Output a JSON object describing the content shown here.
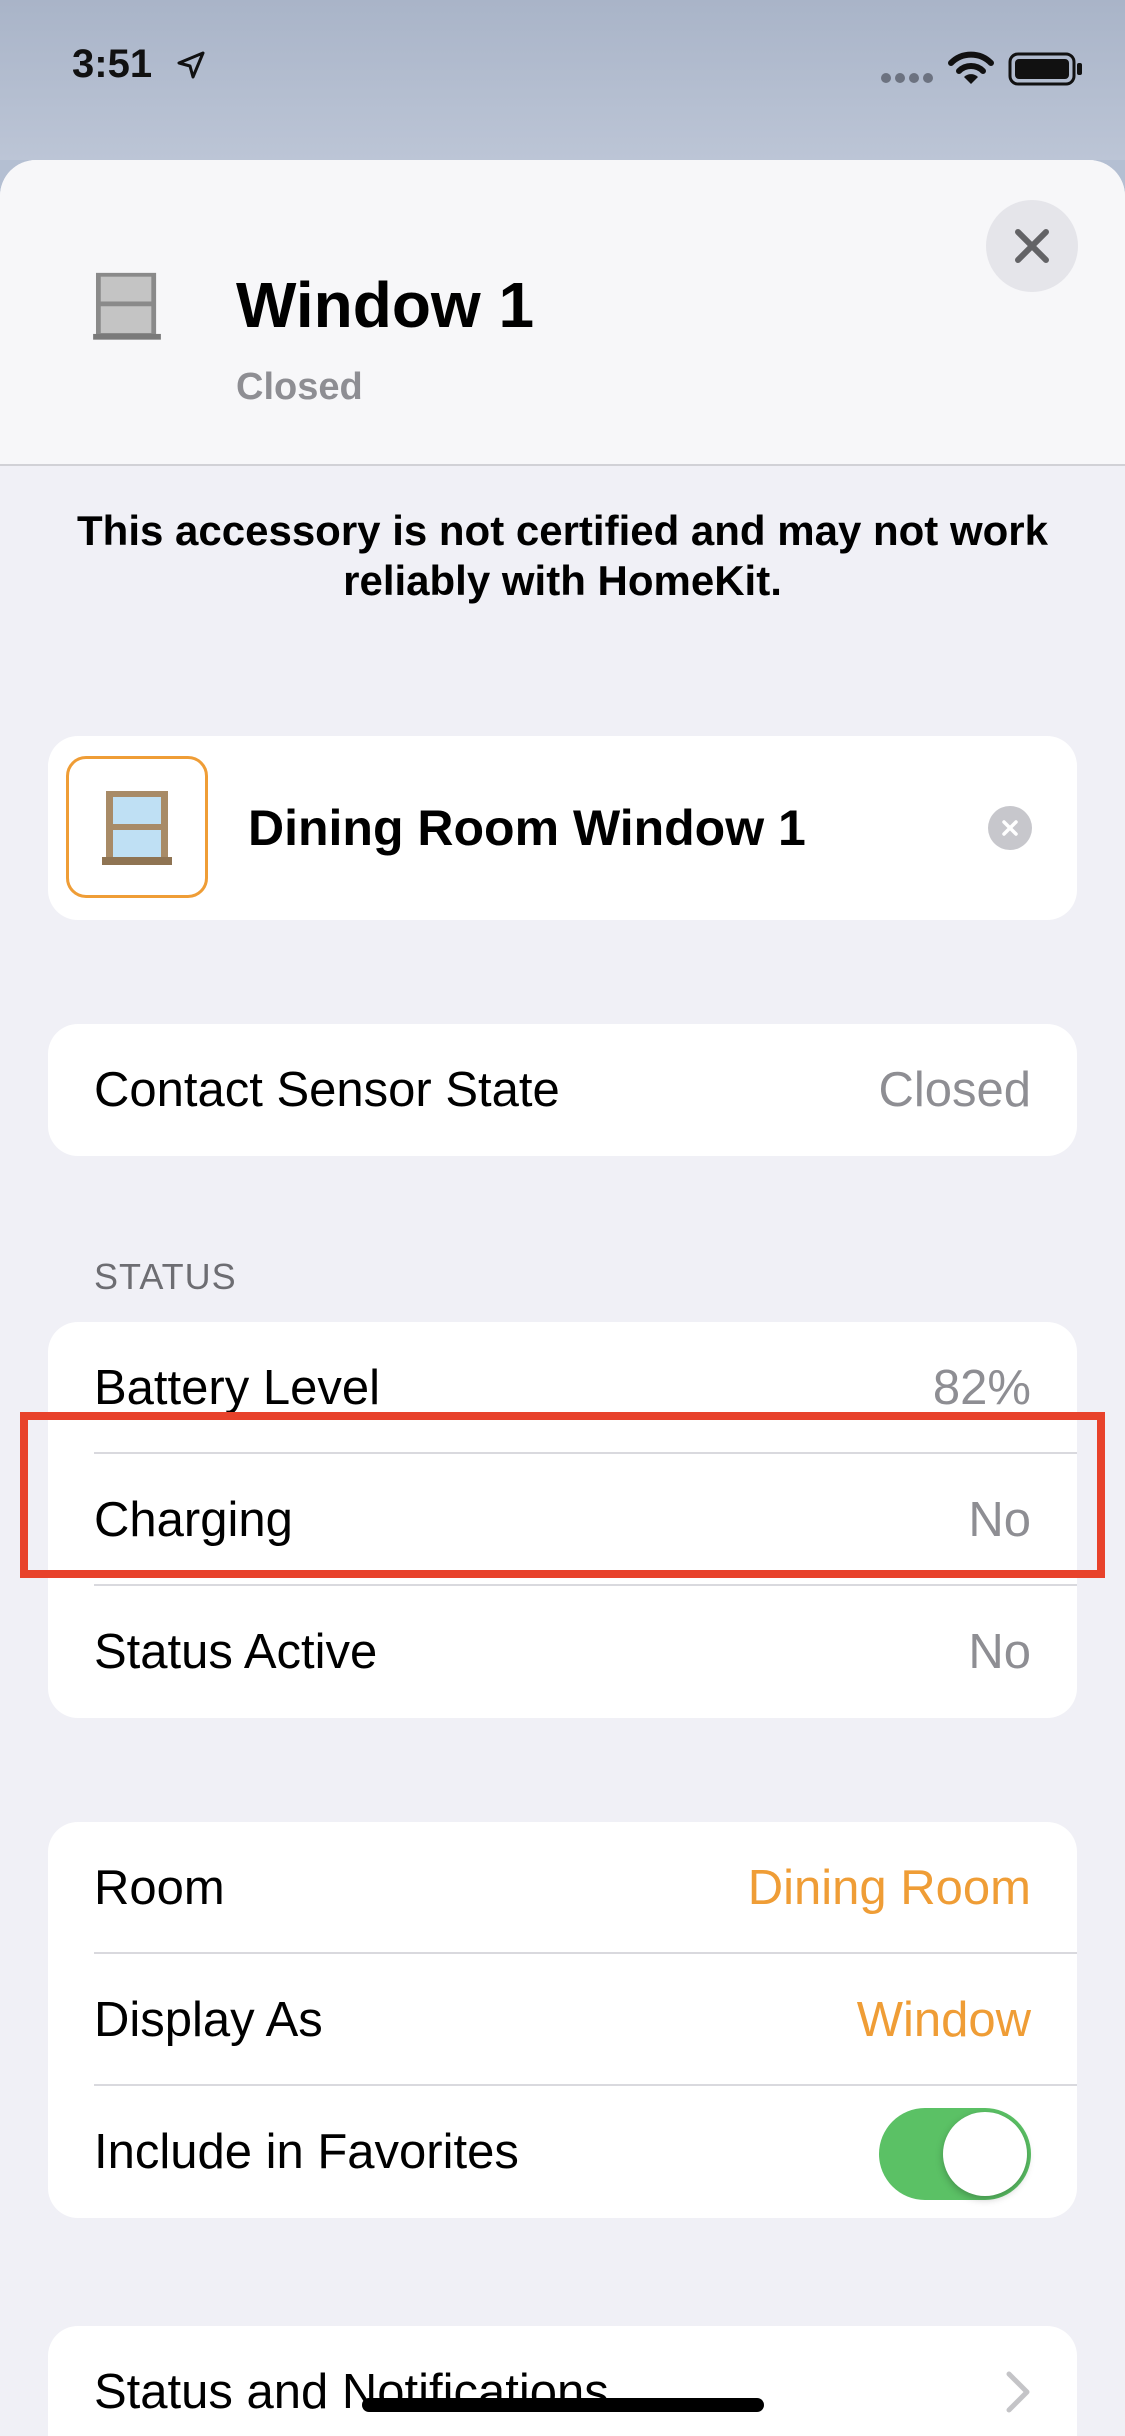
{
  "status_bar": {
    "time": "3:51"
  },
  "header": {
    "title": "Window 1",
    "subtitle": "Closed",
    "icon": "window-icon",
    "close_icon": "close-icon"
  },
  "notice": "This accessory is not certified and may not work reliably with HomeKit.",
  "accessory": {
    "name": "Dining Room Window 1",
    "icon": "window-icon"
  },
  "contact": {
    "label": "Contact Sensor State",
    "value": "Closed"
  },
  "status_section": {
    "header": "STATUS",
    "rows": [
      {
        "label": "Battery Level",
        "value": "82%"
      },
      {
        "label": "Charging",
        "value": "No"
      },
      {
        "label": "Status Active",
        "value": "No"
      }
    ]
  },
  "settings": {
    "room_label": "Room",
    "room_value": "Dining Room",
    "display_label": "Display As",
    "display_value": "Window",
    "favorites_label": "Include in Favorites",
    "favorites_on": true
  },
  "notifications": {
    "label": "Status and Notifications"
  },
  "colors": {
    "accent": "#ef9d36",
    "toggle_on": "#5bc165",
    "highlight": "#e8422b"
  }
}
